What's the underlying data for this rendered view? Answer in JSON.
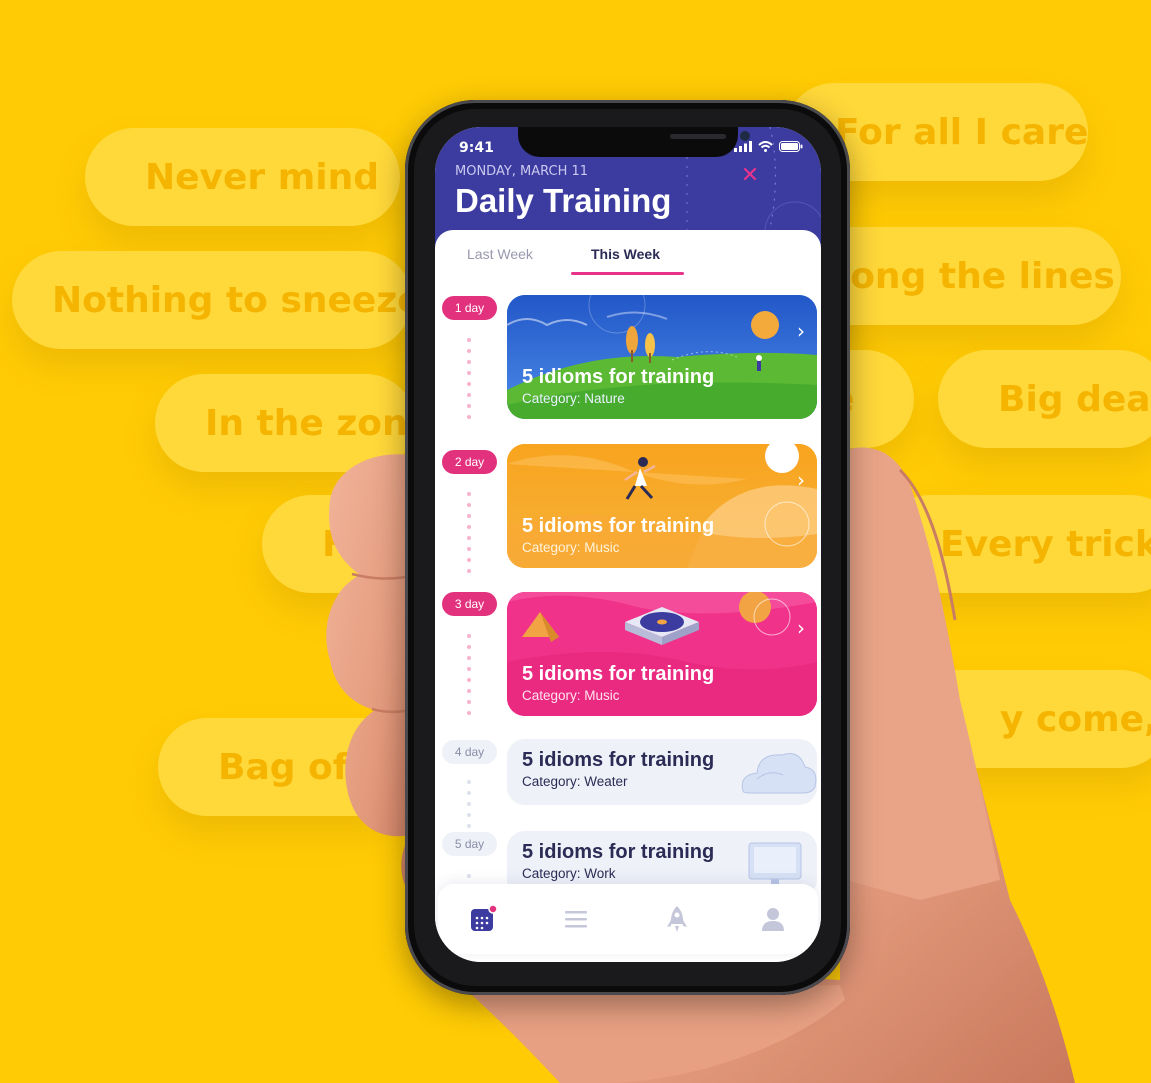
{
  "background_idioms": [
    "For all I care",
    "Never mind",
    "Along the lines",
    "Nothing to sneeze at",
    "In the zone",
    "Big deal",
    "For",
    "Every trick in",
    "Bag of t",
    "y come,",
    "e"
  ],
  "status_bar": {
    "time": "9:41"
  },
  "header": {
    "date": "MONDAY, MARCH 11",
    "title": "Daily Training"
  },
  "tabs": [
    {
      "label": "Last Week",
      "active": false
    },
    {
      "label": "This Week",
      "active": true
    }
  ],
  "days": [
    {
      "label": "1 day",
      "title": "5 idioms for training",
      "category": "Category: Nature",
      "theme": "nature",
      "color": "#2F6FD6"
    },
    {
      "label": "2 day",
      "title": "5 idioms for training",
      "category": "Category: Music",
      "theme": "running",
      "color": "#F9A320"
    },
    {
      "label": "3 day",
      "title": "5 idioms for training",
      "category": "Category: Music",
      "theme": "vinyl",
      "color": "#F1328A"
    },
    {
      "label": "4 day",
      "title": "5 idioms for training",
      "category": "Category: Weater",
      "theme": "cloud",
      "color": "#EEF1F8"
    },
    {
      "label": "5 day",
      "title": "5 idioms for training",
      "category": "Category: Work",
      "theme": "monitor",
      "color": "#EEF1F8"
    }
  ],
  "tab_bar": [
    {
      "name": "calendar-icon",
      "active": true
    },
    {
      "name": "list-icon",
      "active": false
    },
    {
      "name": "rocket-icon",
      "active": false
    },
    {
      "name": "profile-icon",
      "active": false
    }
  ],
  "colors": {
    "background": "#FFCB05",
    "header": "#3B3BA0",
    "accent": "#E2327E"
  }
}
